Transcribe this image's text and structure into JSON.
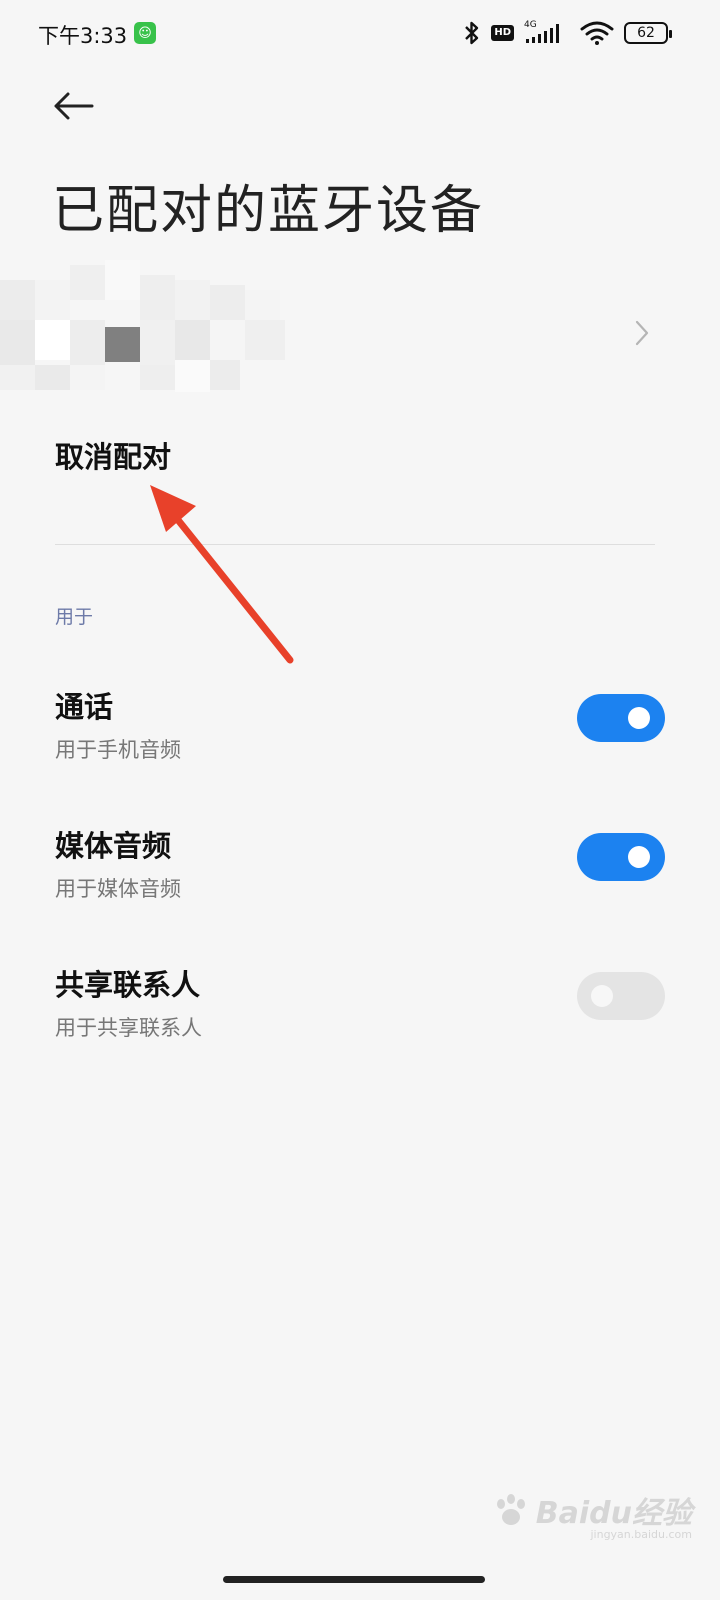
{
  "status_bar": {
    "time": "下午3:33",
    "network_type": "4G",
    "hd_label": "HD",
    "battery": "62"
  },
  "header": {
    "title": "已配对的蓝牙设备"
  },
  "actions": {
    "unpair_label": "取消配对"
  },
  "section": {
    "label": "用于"
  },
  "toggles": [
    {
      "title": "通话",
      "subtitle": "用于手机音频",
      "enabled": true
    },
    {
      "title": "媒体音频",
      "subtitle": "用于媒体音频",
      "enabled": true
    },
    {
      "title": "共享联系人",
      "subtitle": "用于共享联系人",
      "enabled": false
    }
  ],
  "watermark": {
    "text": "Baidu经验",
    "sub": "jingyan.baidu.com"
  },
  "colors": {
    "accent": "#1c82f0",
    "annotation": "#e8412a",
    "background": "#f6f6f6"
  }
}
